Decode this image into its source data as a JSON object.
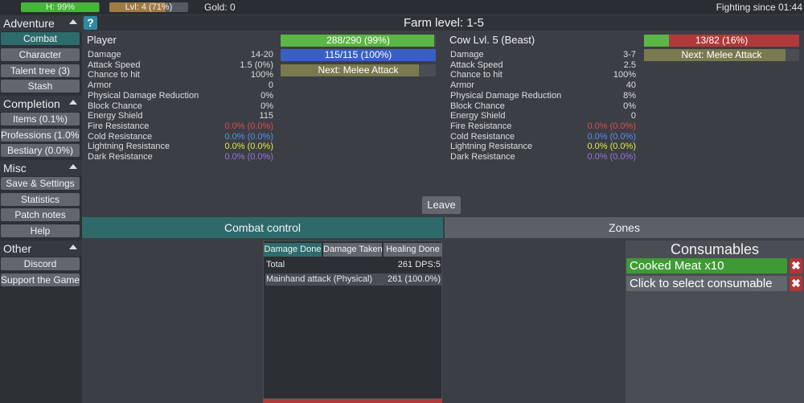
{
  "topbar": {
    "health": {
      "label": "H: 99%",
      "fraction": 0.99,
      "color": "#46b53a"
    },
    "level": {
      "label": "Lvl: 4 (71%)",
      "fraction": 0.71,
      "color": "#a07a45"
    },
    "gold": "Gold: 0",
    "fighting": "Fighting since 01:44"
  },
  "sidebar": {
    "adventure": {
      "title": "Adventure",
      "items": [
        "Combat",
        "Character",
        "Talent tree (3)",
        "Stash"
      ]
    },
    "completion": {
      "title": "Completion",
      "items": [
        "Items (0.1%)",
        "Professions (1.0%)",
        "Bestiary (0.0%)"
      ]
    },
    "misc": {
      "title": "Misc",
      "items": [
        "Save & Settings",
        "Statistics",
        "Patch notes",
        "Help"
      ]
    },
    "other": {
      "title": "Other",
      "items": [
        "Discord",
        "Support the Game"
      ]
    }
  },
  "header": {
    "help_icon": "?",
    "title": "Farm level: 1-5"
  },
  "player": {
    "name": "Player",
    "hp": {
      "label": "288/290 (99%)",
      "fraction": 0.99,
      "color": "#5cb544"
    },
    "energy": {
      "label": "115/115 (100%)",
      "fraction": 1.0,
      "color": "#3a5fc2"
    },
    "next": {
      "label": "Next: Melee Attack",
      "fraction": 0.89,
      "color": "#7a7a50"
    },
    "stats": [
      {
        "label": "Damage",
        "value": "14-20",
        "color": "#dcdcdc"
      },
      {
        "label": "Attack Speed",
        "value": "1.5 (0%)",
        "color": "#dcdcdc"
      },
      {
        "label": "Chance to hit",
        "value": "100%",
        "color": "#dcdcdc"
      },
      {
        "label": "Armor",
        "value": "0",
        "color": "#dcdcdc"
      },
      {
        "label": "Physical Damage Reduction",
        "value": "0%",
        "color": "#dcdcdc"
      },
      {
        "label": "Block Chance",
        "value": "0%",
        "color": "#dcdcdc"
      },
      {
        "label": "Energy Shield",
        "value": "115",
        "color": "#dcdcdc"
      },
      {
        "label": "Fire Resistance",
        "value": "0.0% (0.0%)",
        "color": "#e04b4b"
      },
      {
        "label": "Cold Resistance",
        "value": "0.0% (0.0%)",
        "color": "#5a8ee8"
      },
      {
        "label": "Lightning Resistance",
        "value": "0.0% (0.0%)",
        "color": "#e8e845"
      },
      {
        "label": "Dark Resistance",
        "value": "0.0% (0.0%)",
        "color": "#9a72d8"
      }
    ]
  },
  "enemy": {
    "name": "Cow Lvl. 5 (Beast)",
    "hp": {
      "label": "13/82 (16%)",
      "fraction": 0.16,
      "color": "#5cb544",
      "bg": "#b03a3a"
    },
    "next": {
      "label": "Next: Melee Attack",
      "fraction": 0.91,
      "color": "#7a7a50"
    },
    "stats": [
      {
        "label": "Damage",
        "value": "3-7",
        "color": "#dcdcdc"
      },
      {
        "label": "Attack Speed",
        "value": "2.5",
        "color": "#dcdcdc"
      },
      {
        "label": "Chance to hit",
        "value": "100%",
        "color": "#dcdcdc"
      },
      {
        "label": "Armor",
        "value": "40",
        "color": "#dcdcdc"
      },
      {
        "label": "Physical Damage Reduction",
        "value": "8%",
        "color": "#dcdcdc"
      },
      {
        "label": "Block Chance",
        "value": "0%",
        "color": "#dcdcdc"
      },
      {
        "label": "Energy Shield",
        "value": "0",
        "color": "#dcdcdc"
      },
      {
        "label": "Fire Resistance",
        "value": "0.0% (0.0%)",
        "color": "#e04b4b"
      },
      {
        "label": "Cold Resistance",
        "value": "0.0% (0.0%)",
        "color": "#5a8ee8"
      },
      {
        "label": "Lightning Resistance",
        "value": "0.0% (0.0%)",
        "color": "#e8e845"
      },
      {
        "label": "Dark Resistance",
        "value": "0.0% (0.0%)",
        "color": "#9a72d8"
      }
    ]
  },
  "leave_label": "Leave",
  "tabs": {
    "combat": "Combat control",
    "zones": "Zones"
  },
  "meter": {
    "tabs": [
      "Damage Done",
      "Damage Taken",
      "Healing Done"
    ],
    "total": {
      "label": "Total",
      "value": "261 DPS:5"
    },
    "rows": [
      {
        "label": "Mainhand attack (Physical)",
        "value": "261 (100.0%)"
      }
    ]
  },
  "consumables": {
    "title": "Consumables",
    "items": [
      {
        "label": "Cooked Meat x10",
        "color": "#3f9a36"
      },
      {
        "label": "Click to select consumable",
        "color": "#62676e"
      }
    ],
    "remove_icon": "✖"
  }
}
